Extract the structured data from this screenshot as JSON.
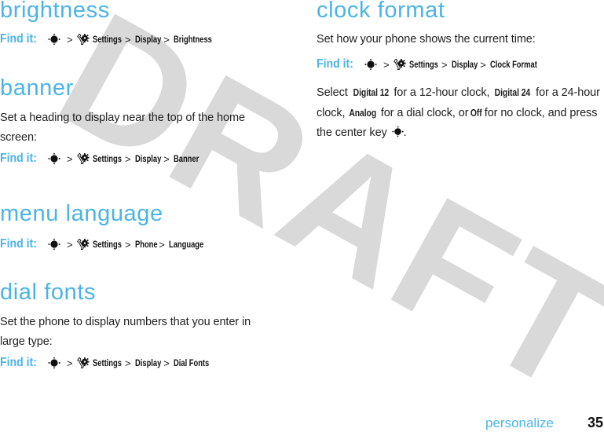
{
  "watermark": "DRAFT",
  "colors": {
    "heading": "#4bb4e6",
    "watermark": "#d9d9d9",
    "text": "#222222"
  },
  "icons": {
    "nav_key": "nav-key-icon",
    "settings": "settings-gear-wrench-icon"
  },
  "find_it_label": "Find it:",
  "separator": ">",
  "left_column": {
    "sections": [
      {
        "heading": "brightness",
        "body": "",
        "path": [
          "Settings",
          "Display",
          "Brightness"
        ]
      },
      {
        "heading": "banner",
        "body": "Set a heading to display near the top of the home screen:",
        "path": [
          "Settings",
          "Display",
          "Banner"
        ]
      },
      {
        "heading": "menu language",
        "body": "",
        "path": [
          "Settings",
          "Phone",
          "Language"
        ]
      },
      {
        "heading": "dial fonts",
        "body": "Set the phone to display numbers that you enter in large type:",
        "path": [
          "Settings",
          "Display",
          "Dial Fonts"
        ]
      }
    ]
  },
  "right_column": {
    "section": {
      "heading": "clock format",
      "body": "Set how your phone shows the current time:",
      "path": [
        "Settings",
        "Display",
        "Clock Format"
      ],
      "instructions": {
        "t1": "Select ",
        "opt1": "Digital 12",
        "t2": " for a 12-hour clock, ",
        "opt2": "Digital 24",
        "t3": " for a 24-hour clock, ",
        "opt3": "Analog",
        "t4": " for a dial clock, or ",
        "opt4": "Off",
        "t5": " for no clock, and press the center key ",
        "t6": "."
      }
    }
  },
  "footer": {
    "section": "personalize",
    "page_number": "35"
  }
}
